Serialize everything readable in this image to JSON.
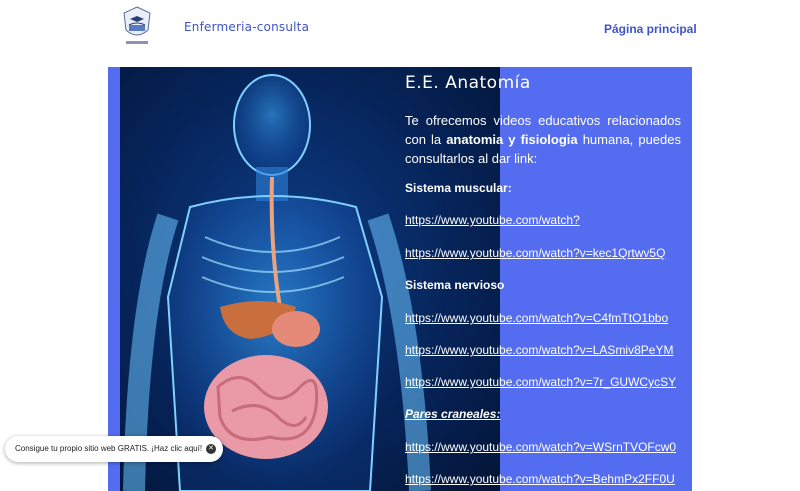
{
  "header": {
    "site_title": "Enfermeria-consulta",
    "nav_home": "Página principal"
  },
  "main": {
    "title": "E.E. Anatomía",
    "intro_pre": "Te ofrecemos videos educativos relacionados con la ",
    "intro_bold": "anatomia y fisiologia",
    "intro_post": " humana, puedes consultarlos al dar link:",
    "sections": [
      {
        "label": "Sistema muscular:",
        "links": [
          "https://www.youtube.com/watch?",
          "https://www.youtube.com/watch?v=kec1Qrtwv5Q"
        ]
      },
      {
        "label": "Sistema nervioso",
        "links": [
          "https://www.youtube.com/watch?v=C4fmTtO1bbo",
          "https://www.youtube.com/watch?v=LASmiv8PeYM",
          "https://www.youtube.com/watch?v=7r_GUWCycSY"
        ]
      },
      {
        "label": "Pares craneales:",
        "links": [
          "https://www.youtube.com/watch?v=WSrnTVOFcw0",
          "https://www.youtube.com/watch?v=BehmPx2FF0U"
        ]
      }
    ]
  },
  "promo": {
    "text": "Consigue tu propio sitio web GRATIS. ¡Haz clic aquí!",
    "close_icon": "close-icon"
  },
  "colors": {
    "panel": "#546cf0",
    "accent": "#3f53c9"
  }
}
